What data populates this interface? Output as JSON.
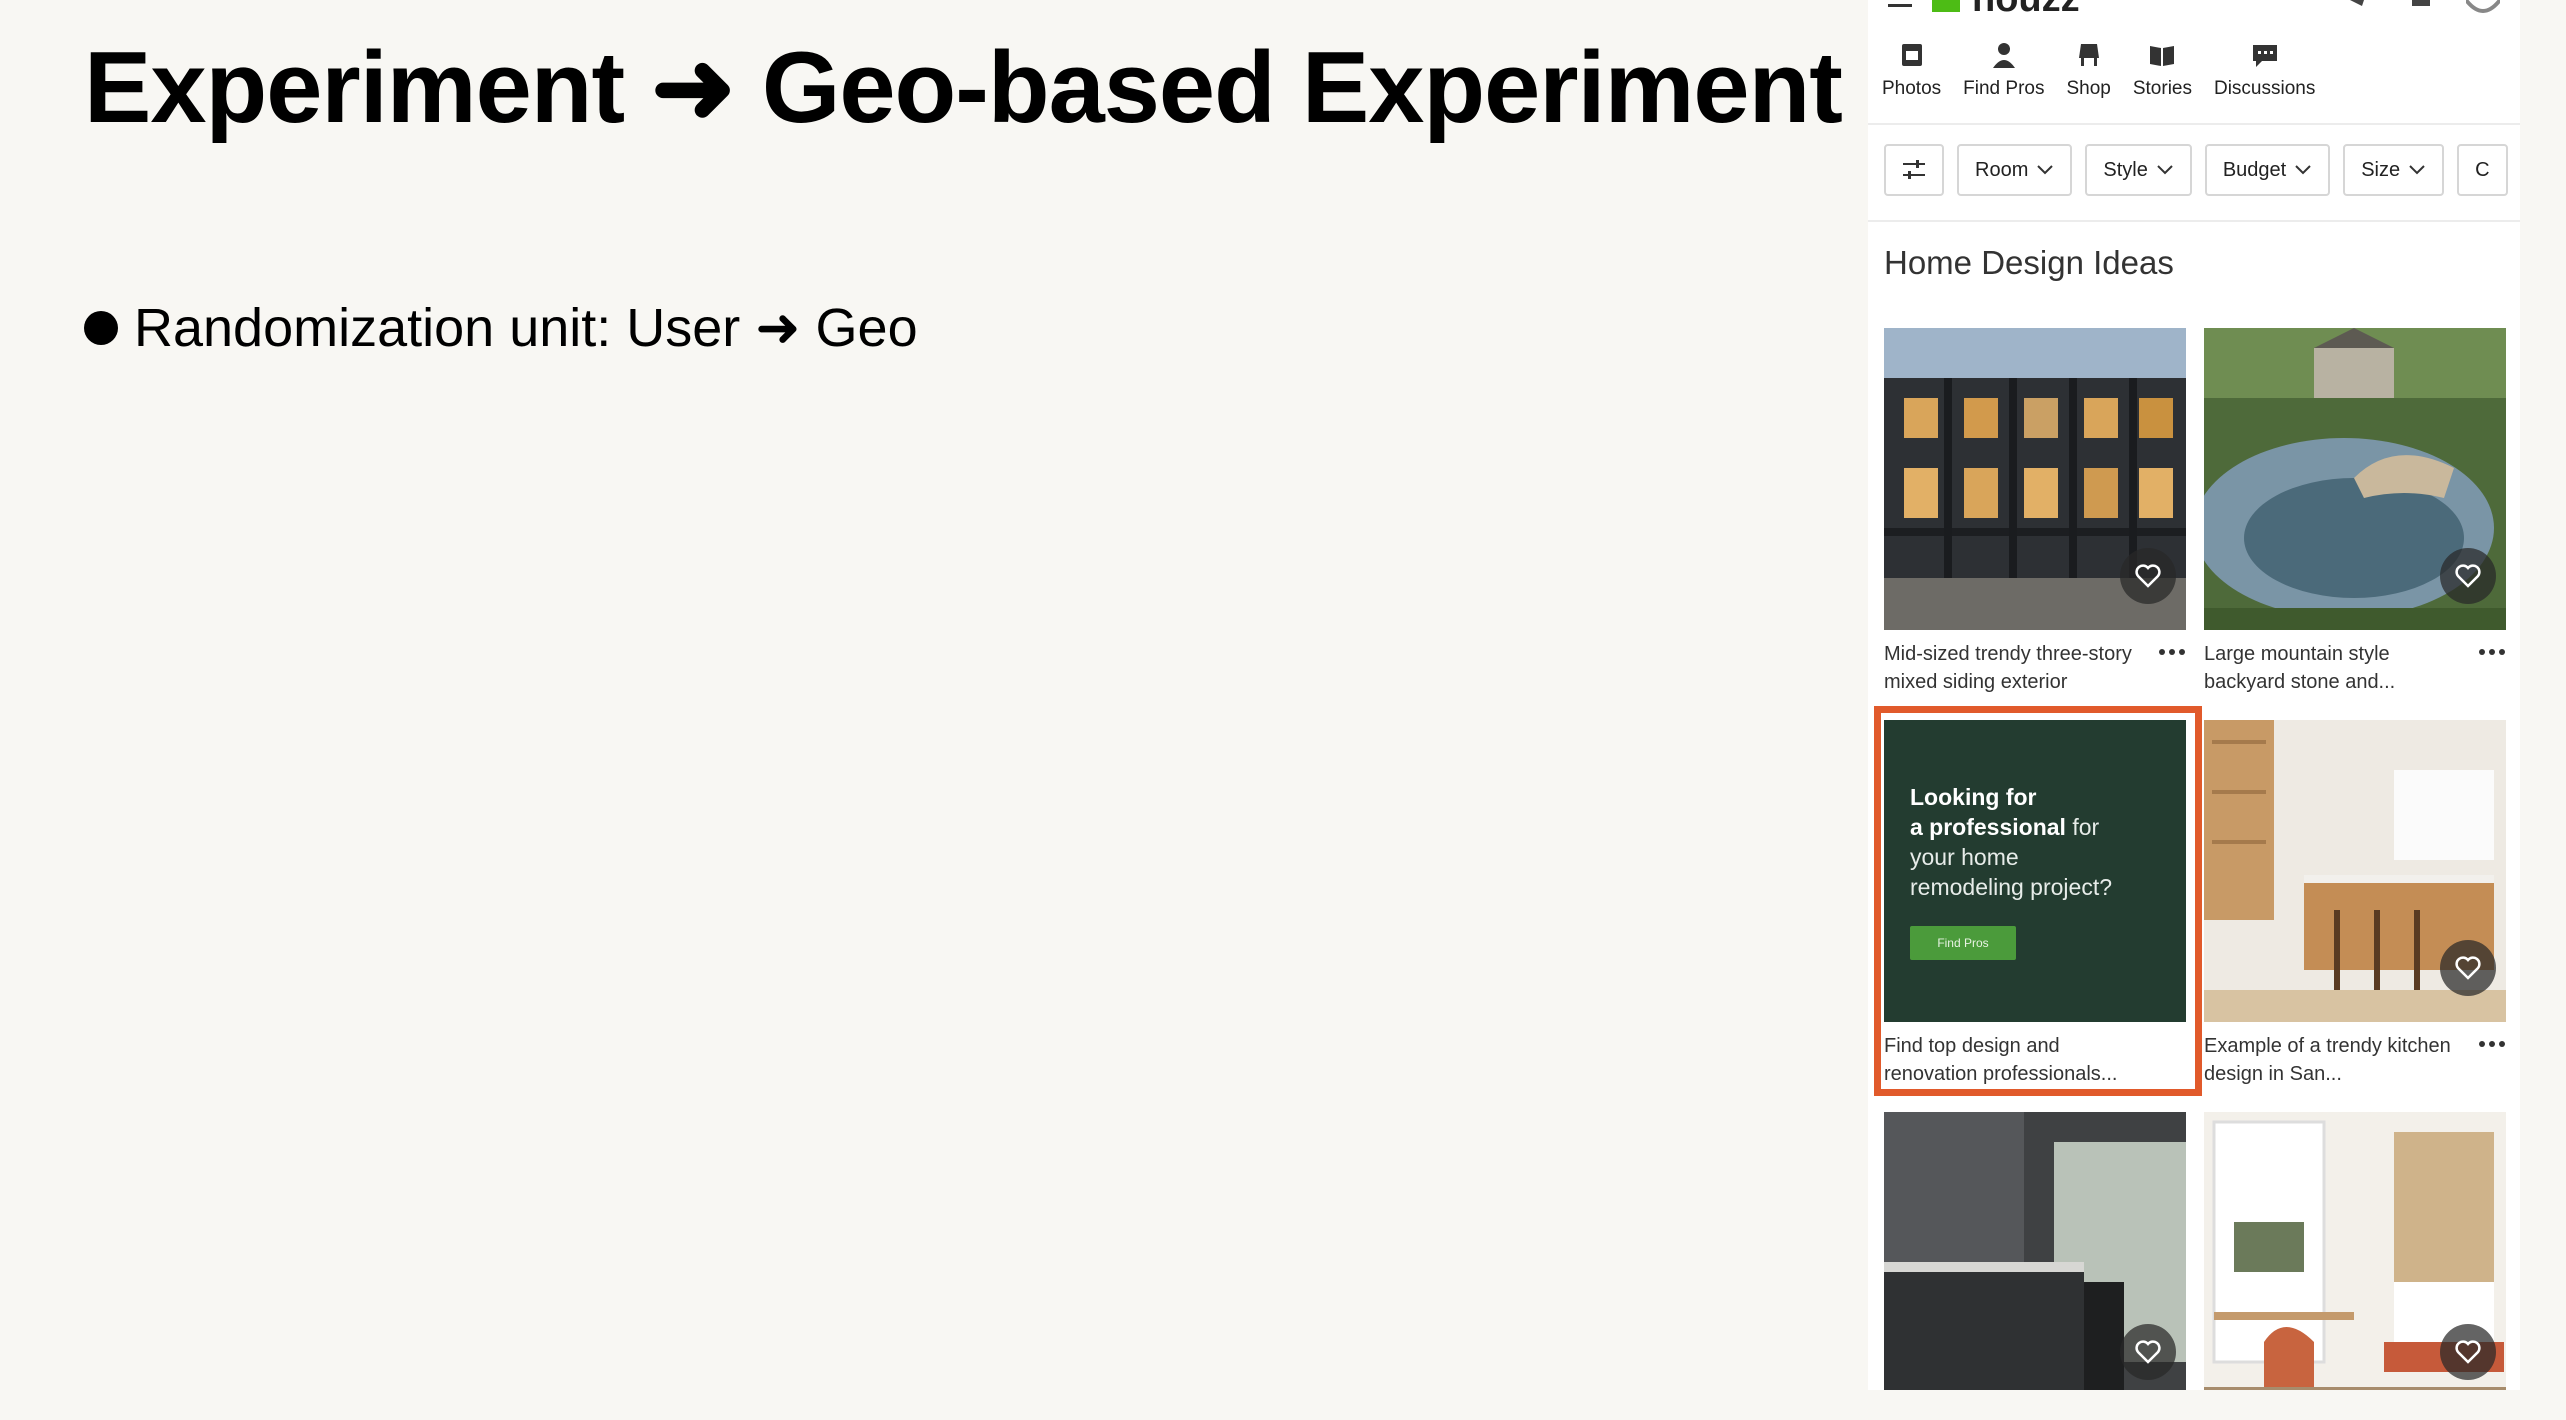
{
  "slide": {
    "title": "Experiment ➜ Geo-based Experiment",
    "bullet": "Randomization unit: User ➜ Geo"
  },
  "app": {
    "logo": "houzz",
    "brand_color": "#4dbc15",
    "nav": [
      {
        "label": "Photos",
        "icon": "photos-icon"
      },
      {
        "label": "Find Pros",
        "icon": "find-pros-icon"
      },
      {
        "label": "Shop",
        "icon": "shop-icon"
      },
      {
        "label": "Stories",
        "icon": "stories-icon"
      },
      {
        "label": "Discussions",
        "icon": "discussions-icon"
      }
    ],
    "filters": [
      "Room",
      "Style",
      "Budget",
      "Size",
      "C"
    ],
    "section_title": "Home Design Ideas",
    "cards": [
      {
        "caption": "Mid-sized trendy three-story mixed siding exterior",
        "image": "modern-townhouse-exterior"
      },
      {
        "caption": "Large mountain style backyard stone and...",
        "image": "stone-pool-backyard"
      },
      {
        "caption": "Find top design and renovation professionals...",
        "image": "ad"
      },
      {
        "caption": "Example of a trendy kitchen design in San...",
        "image": "wood-kitchen-island"
      },
      {
        "caption": "",
        "image": "dark-gray-kitchen"
      },
      {
        "caption": "",
        "image": "white-built-in-office"
      }
    ],
    "ad": {
      "line1": "Looking for",
      "line2_bold": "a professional",
      "line2_rest": " for",
      "line3": "your home",
      "line4": "remodeling project?",
      "button": "Find Pros",
      "highlight_color": "#e15a2b"
    }
  }
}
